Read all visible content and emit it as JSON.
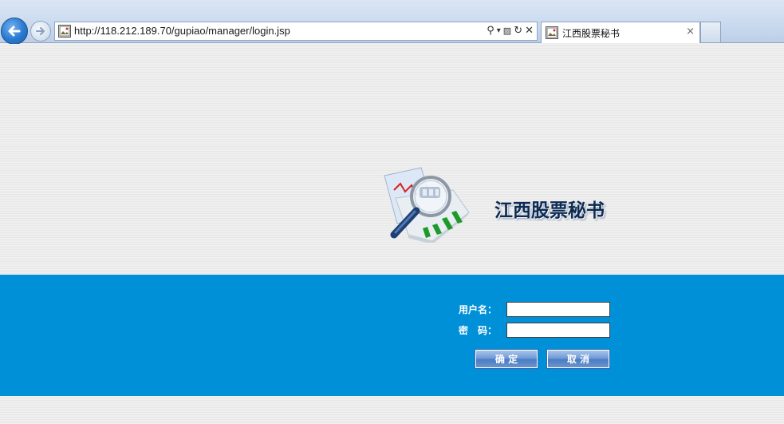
{
  "browser": {
    "address_bar": {
      "url": "http://118.212.189.70/gupiao/manager/login.jsp"
    },
    "tab": {
      "title": "江西股票秘书",
      "close_glyph": "×"
    },
    "address_tools": {
      "search_glyph": "⚲",
      "dropdown_glyph": "▾",
      "compat_glyph": "▨",
      "refresh_glyph": "↻",
      "stop_glyph": "✕"
    }
  },
  "page": {
    "title": "江西股票秘书",
    "logo_icon": "magnifier-over-stock-chart-icon",
    "login": {
      "username_label": "用户名：",
      "password_label": "密　码：",
      "username_value": "",
      "password_value": "",
      "ok_label": "确 定",
      "cancel_label": "取 消"
    }
  },
  "colors": {
    "band": "#0090d8",
    "title": "#0c2a52",
    "button": "#6f9bd6"
  }
}
